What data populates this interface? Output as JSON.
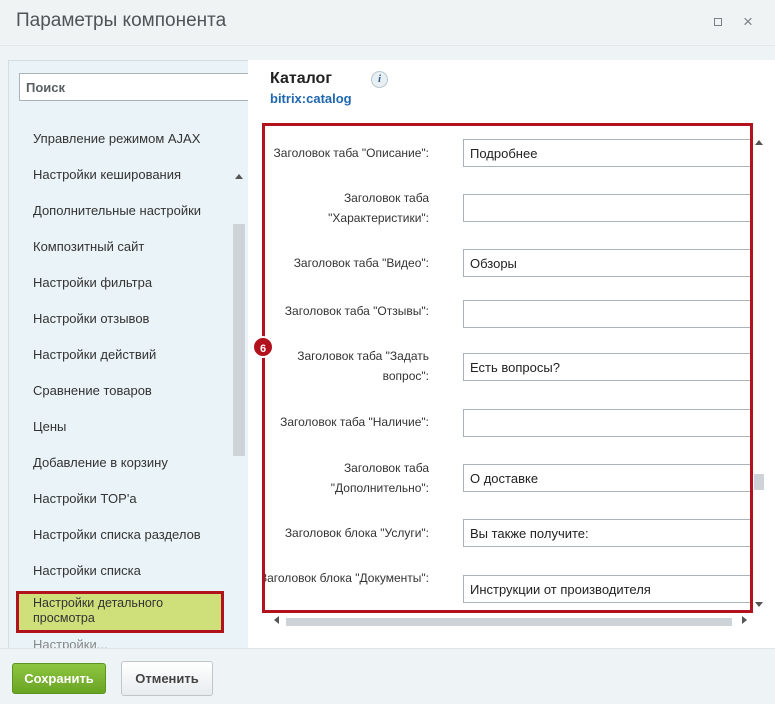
{
  "window": {
    "title": "Параметры компонента",
    "close_glyph": "×"
  },
  "sidebar": {
    "search_placeholder": "Поиск",
    "items": [
      {
        "label": "Управление режимом AJAX"
      },
      {
        "label": "Настройки кеширования"
      },
      {
        "label": "Дополнительные настройки"
      },
      {
        "label": "Композитный сайт"
      },
      {
        "label": "Настройки фильтра"
      },
      {
        "label": "Настройки отзывов"
      },
      {
        "label": "Настройки действий"
      },
      {
        "label": "Сравнение товаров"
      },
      {
        "label": "Цены"
      },
      {
        "label": "Добавление в корзину"
      },
      {
        "label": "Настройки TOP'a"
      },
      {
        "label": "Настройки списка разделов"
      },
      {
        "label": "Настройки списка"
      },
      {
        "label": "Настройки детального просмотра"
      },
      {
        "label": "Настройки..."
      }
    ],
    "active_index": 13
  },
  "component": {
    "title": "Каталог",
    "code": "bitrix:catalog",
    "info_glyph": "i"
  },
  "annotation_badge": "6",
  "form": {
    "fields": [
      {
        "label": "Заголовок таба \"Описание\":",
        "value": "Подробнее"
      },
      {
        "label": "Заголовок таба \"Характеристики\":",
        "value": ""
      },
      {
        "label": "Заголовок таба \"Видео\":",
        "value": "Обзоры"
      },
      {
        "label": "Заголовок таба \"Отзывы\":",
        "value": ""
      },
      {
        "label": "Заголовок таба \"Задать вопрос\":",
        "value": "Есть вопросы?"
      },
      {
        "label": "Заголовок таба \"Наличие\":",
        "value": ""
      },
      {
        "label": "Заголовок таба \"Дополнительно\":",
        "value": "О доставке"
      },
      {
        "label": "Заголовок блока \"Услуги\":",
        "value": "Вы также получите:"
      },
      {
        "label": "Заголовок блока \"Документы\":",
        "value": "Инструкции от производителя"
      }
    ]
  },
  "footer": {
    "save_label": "Сохранить",
    "cancel_label": "Отменить"
  }
}
